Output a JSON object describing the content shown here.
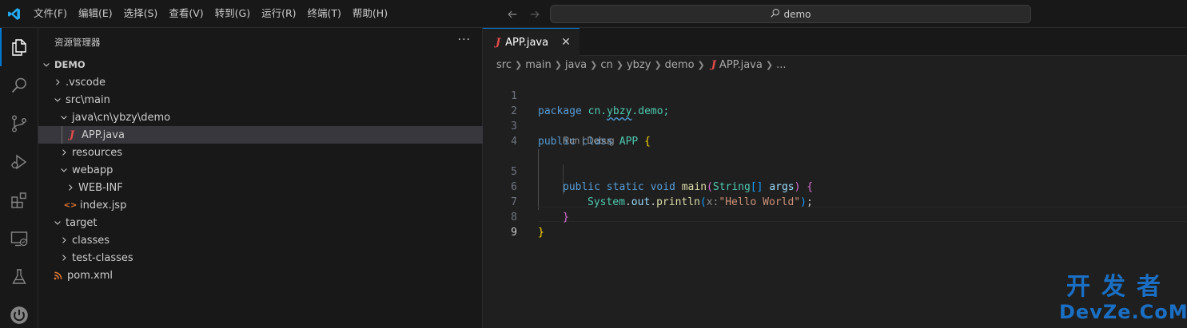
{
  "titlebar": {
    "menus": [
      "文件(F)",
      "编辑(E)",
      "选择(S)",
      "查看(V)",
      "转到(G)",
      "运行(R)",
      "终端(T)",
      "帮助(H)"
    ],
    "search_text": "demo"
  },
  "activity": {
    "items": [
      "explorer-icon",
      "search-icon",
      "source-control-icon",
      "run-debug-icon",
      "extensions-icon",
      "remote-explorer-icon",
      "testing-icon",
      "spring-boot-icon"
    ]
  },
  "sidebar": {
    "title": "资源管理器",
    "more": "···",
    "root": "DEMO",
    "tree": [
      {
        "label": ".vscode"
      },
      {
        "label": "src\\main"
      },
      {
        "label": "java\\cn\\ybzy\\demo"
      },
      {
        "label": "APP.java",
        "icon": "J"
      },
      {
        "label": "resources"
      },
      {
        "label": "webapp"
      },
      {
        "label": "WEB-INF"
      },
      {
        "label": "index.jsp",
        "icon": "<>"
      },
      {
        "label": "target"
      },
      {
        "label": "classes"
      },
      {
        "label": "test-classes"
      },
      {
        "label": "pom.xml",
        "icon": "rss"
      }
    ]
  },
  "editor": {
    "tab": {
      "icon": "J",
      "label": "APP.java",
      "close": "✕"
    },
    "breadcrumbs": [
      "src",
      "main",
      "java",
      "cn",
      "ybzy",
      "demo",
      "APP.java",
      "..."
    ],
    "line_numbers": [
      "1",
      "2",
      "3",
      "4",
      "5",
      "6",
      "7",
      "8",
      "9"
    ],
    "code": {
      "l1_kw": "package",
      "l1_a": "cn.",
      "l1_b": "ybzy",
      "l1_c": ".demo;",
      "l3_kw1": "public",
      "l3_kw2": "class",
      "l3_cls": "APP",
      "l3_brace": "{",
      "codelens": "Run | Debug",
      "l5_kw1": "public",
      "l5_kw2": "static",
      "l5_kw3": "void",
      "l5_fn": "main",
      "l5_p": "(",
      "l5_type": "String",
      "l5_arr": "[]",
      "l5_arg": "args",
      "l5_pc": ")",
      "l5_brace": "{",
      "l6_cls": "System",
      "l6_dot1": ".",
      "l6_out": "out",
      "l6_dot2": ".",
      "l6_fn": "println",
      "l6_p": "(",
      "l6_hint": "x:",
      "l6_str": "\"Hello World\"",
      "l6_pc": ")",
      "l6_semi": ";",
      "l7_brace": "}",
      "l8_brace": "}"
    }
  },
  "watermark": {
    "top": "开发者",
    "bottom": "DevZe.CoM"
  }
}
